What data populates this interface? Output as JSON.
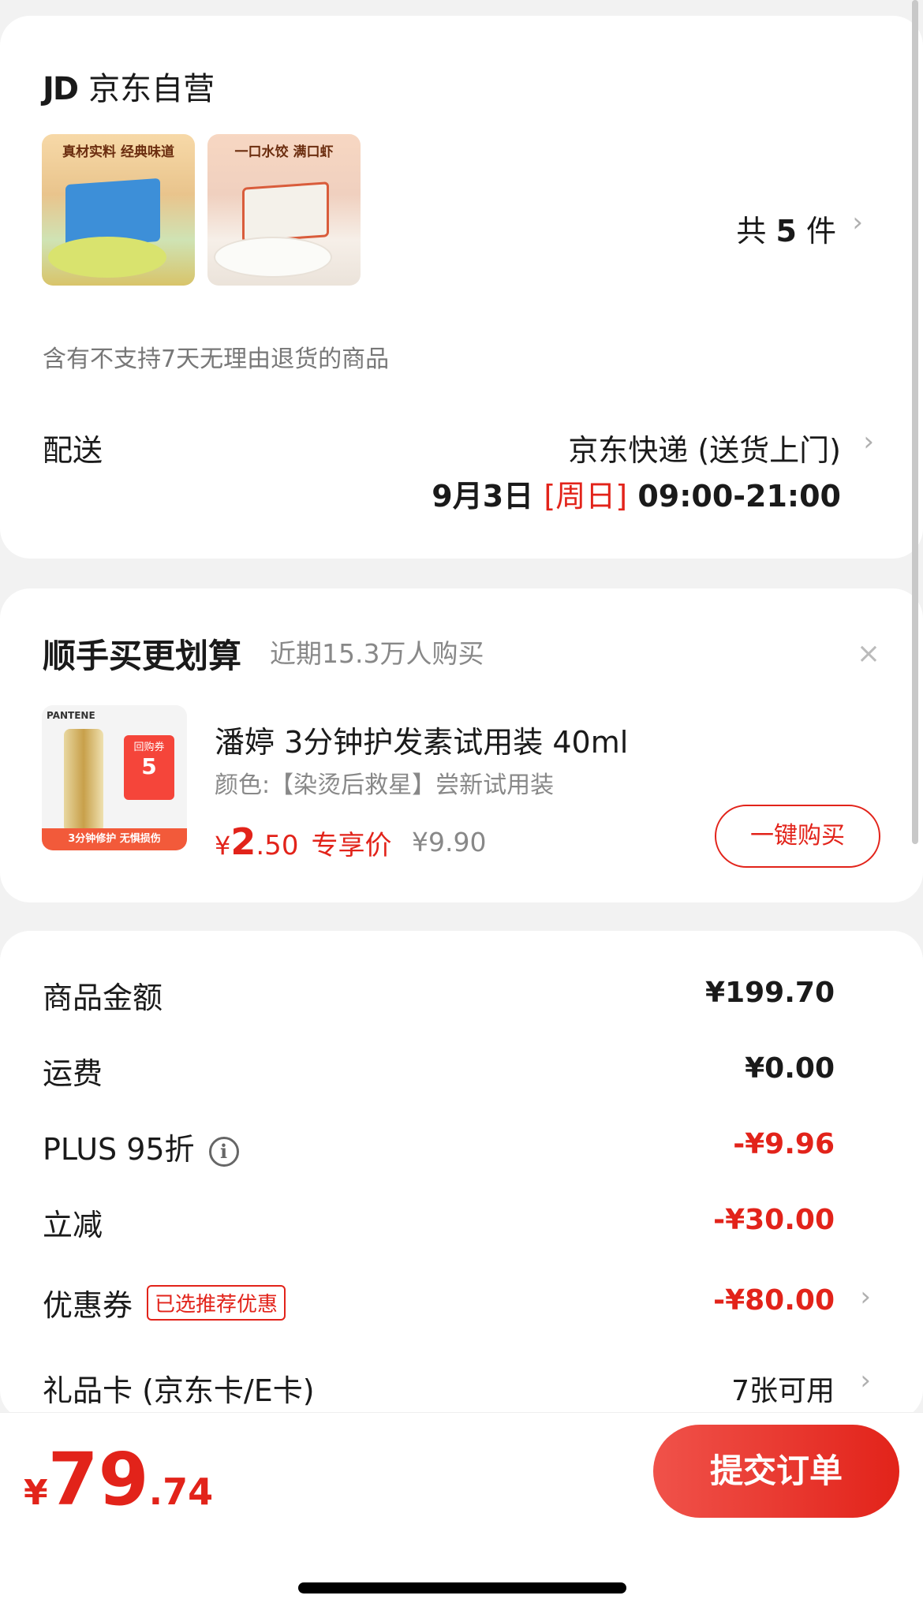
{
  "shop": {
    "logo": "JD",
    "name": "京东自营",
    "products": [
      {
        "banner": "真材实料 经典味道",
        "icon": "dumpling-box-image"
      },
      {
        "banner": "一口水饺 满口虾",
        "icon": "shrimp-dumpling-image"
      }
    ],
    "count_prefix": "共",
    "count": "5",
    "count_suffix": "件",
    "return_notice": "含有不支持7天无理由退货的商品"
  },
  "delivery": {
    "label": "配送",
    "method": "京东快递 (送货上门)",
    "date": "9月3日",
    "weekday": "[周日]",
    "time": "09:00-21:00"
  },
  "recommend": {
    "title": "顺手买更划算",
    "subtitle": "近期15.3万人购买",
    "close": "×",
    "product_brand": "PANTENE",
    "coupon_title": "回购券",
    "coupon_value": "5",
    "product_stripe": "3分钟修护 无惧损伤",
    "product_name": "潘婷 3分钟护发素试用装 40ml",
    "spec": "颜色:【染烫后救星】尝新试用装",
    "price_symbol": "¥",
    "price_int": "2",
    "price_dec": ".50",
    "price_tag": "专享价",
    "original_price": "¥9.90",
    "buy_label": "一键购买"
  },
  "summary": {
    "rows": [
      {
        "label": "商品金额",
        "value": "¥199.70"
      },
      {
        "label": "运费",
        "value": "¥0.00"
      },
      {
        "label": "PLUS 95折",
        "value": "-¥9.96"
      },
      {
        "label": "立减",
        "value": "-¥30.00"
      },
      {
        "label": "优惠券",
        "badge": "已选推荐优惠",
        "value": "-¥80.00"
      },
      {
        "label": "礼品卡 (京东卡/E卡)",
        "value": "7张可用"
      }
    ]
  },
  "footer": {
    "total_symbol": "¥",
    "total_int": "79",
    "total_dec": ".74",
    "submit_label": "提交订单"
  },
  "colors": {
    "accent": "#e2231a",
    "background": "#f2f2f2"
  }
}
